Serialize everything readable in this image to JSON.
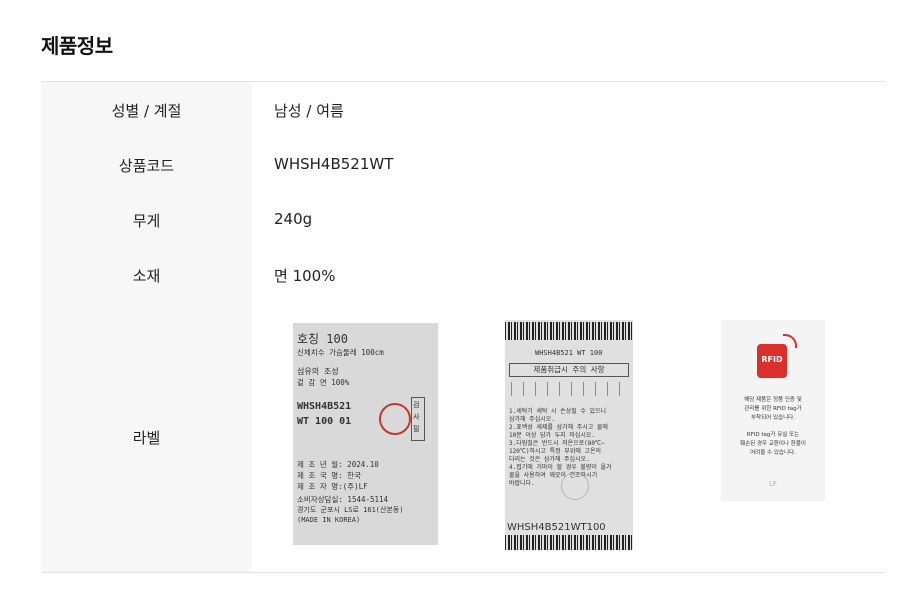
{
  "section_title": "제품정보",
  "rows": [
    {
      "label": "성별 / 계절",
      "value": "남성 / 여름"
    },
    {
      "label": "상품코드",
      "value": "WHSH4B521WT"
    },
    {
      "label": "무게",
      "value": "240g"
    },
    {
      "label": "소재",
      "value": "면 100%"
    },
    {
      "label": "라벨"
    }
  ],
  "label_images": {
    "tag1": {
      "size_line": "호칭     100",
      "chest_line": "신체치수 가슴둘레        100cm",
      "fiber_line": "섬유의 조성",
      "material_line": "겉 감          면        100%",
      "style_code_1": "WHSH4B521",
      "style_code_2": "WT 100 01",
      "inspect": "검사필",
      "mfg_date": "제 조 년 월: 2024.10",
      "mfg_country": "제 조 국 명: 한국",
      "maker": "제 조 자 명:(주)LF",
      "consumer": "소비자상담실: 1544-5114",
      "address": "경기도 군포시 LS로 161(산본동)",
      "made_in": "(MADE IN KOREA)"
    },
    "tag2": {
      "code_top": "WHSH4B521 WT 100",
      "care_header": "제품취급시 주의 사항",
      "care_1": "1.세탁기 세탁 시 손상될 수 있으니",
      "care_1b": "  삼가해 주십시오.",
      "care_2": "2.표백성 세제를 삼가해 주시고 물에",
      "care_2b": "  10분 이상 담가 두지 마십시오.",
      "care_3": "3.다림질은 반드시 저온으로(80℃~",
      "care_3b": "  120℃)하시고 특정 부위에 고온의",
      "care_3c": "  다리는 것은 삼가해 주십시오.",
      "care_4": "4.접기에 거마이 할 경우 불량이 올거",
      "care_4b": "  물을 사용하여 깨끗이 건조하시기",
      "care_4c": "  바랍니다.",
      "code_bottom": "WHSH4B521WT100"
    },
    "tag3": {
      "logo": "RFID",
      "text_1": "해당 제품은 정품 인증 및",
      "text_2": "관리를 위한 RFID tag가",
      "text_3": "부착되어 있습니다.",
      "text_4": "RFID tag가 유실 또는",
      "text_5": "훼손된 경우 교환이나 환불이",
      "text_6": "어려울 수 있습니다.",
      "brand": "LF"
    }
  },
  "colors": {
    "label_column_bg": "#f7f7f7",
    "divider": "#e2e2e2",
    "rfid_red": "#d9302c",
    "stamp_red": "#c0392b"
  }
}
